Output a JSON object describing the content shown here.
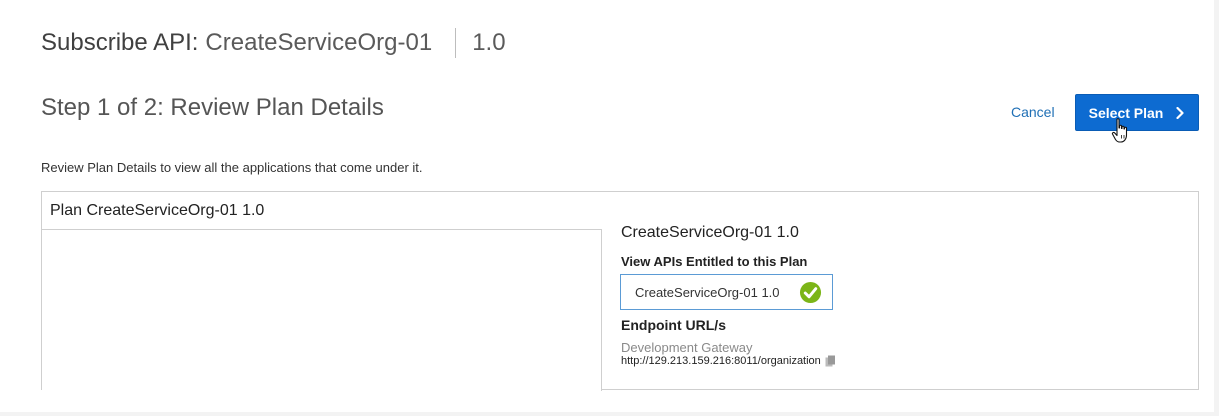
{
  "header": {
    "prefix": "Subscribe API:",
    "api_name": "CreateServiceOrg-01",
    "version": "1.0"
  },
  "step": {
    "title": "Step 1 of 2: Review Plan Details",
    "description": "Review Plan Details to view all the applications that come under it."
  },
  "actions": {
    "cancel_label": "Cancel",
    "select_label": "Select Plan"
  },
  "plan": {
    "tab_label": "Plan CreateServiceOrg-01 1.0",
    "detail_title": "CreateServiceOrg-01 1.0",
    "apis_label": "View APIs Entitled to this Plan",
    "apis": [
      {
        "label": "CreateServiceOrg-01 1.0",
        "status_icon": "check-circle-icon"
      }
    ],
    "endpoint_label": "Endpoint URL/s",
    "gateway_name": "Development Gateway",
    "gateway_url": "http://129.213.159.216:8011/organization"
  },
  "colors": {
    "primary_button": "#0d6bd1",
    "link": "#1f6fb5",
    "success": "#7cb518"
  }
}
